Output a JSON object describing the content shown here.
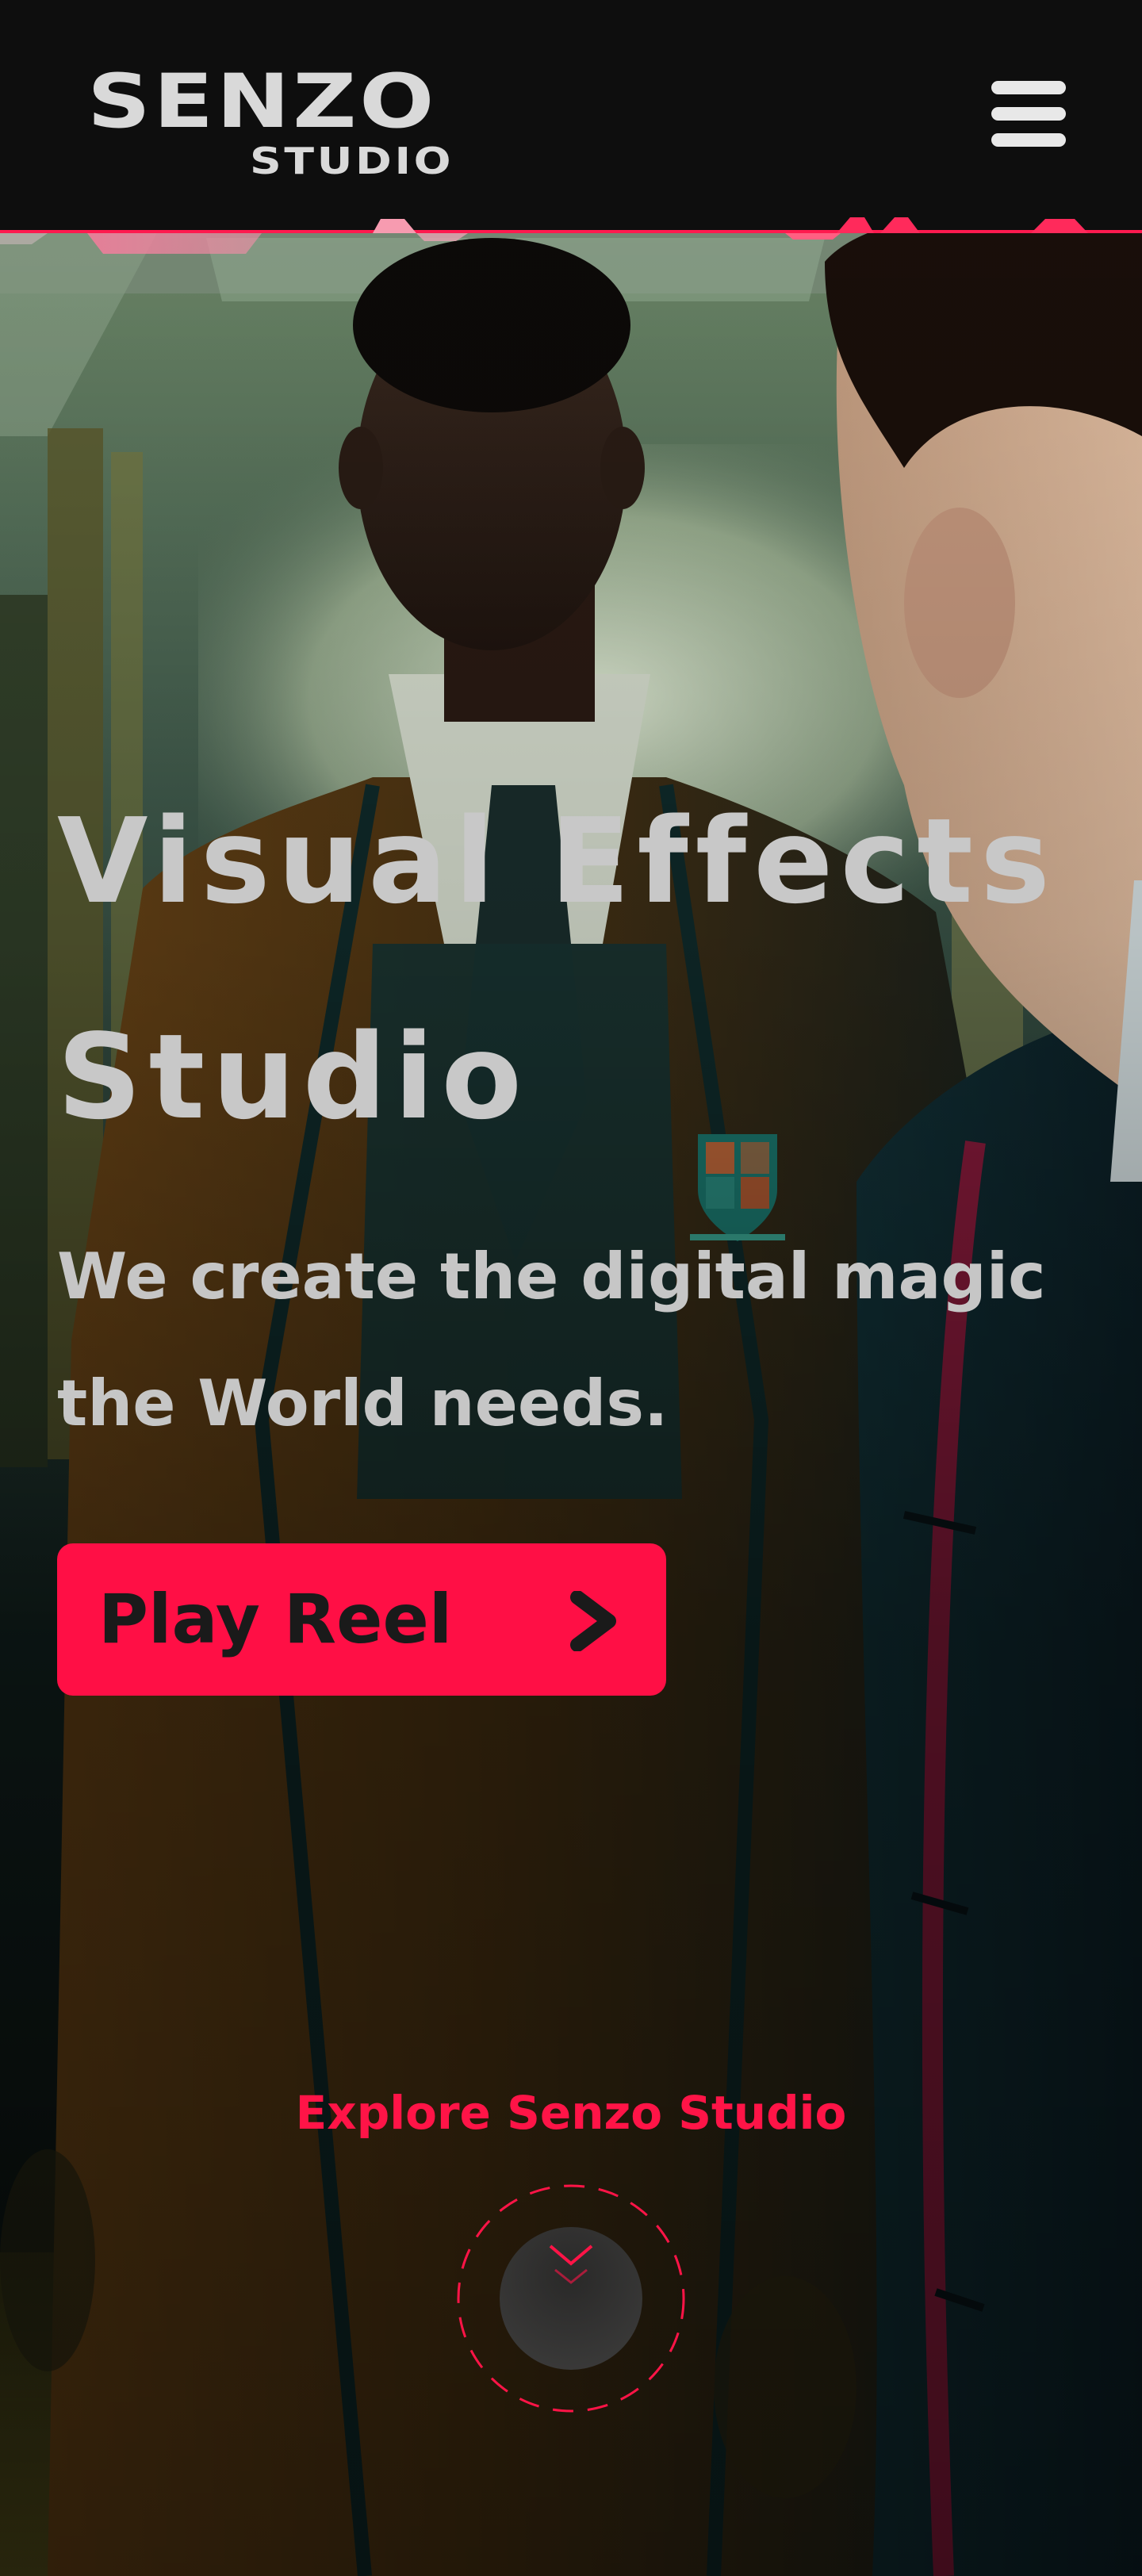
{
  "header": {
    "logo_main": "SENZO",
    "logo_sub": "STUDIO",
    "menu_icon": "hamburger-menu-icon"
  },
  "hero": {
    "title_line1": "Visual Effects",
    "title_line2": "Studio",
    "subtitle_line1": "We create the digital magic",
    "subtitle_line2": "the World needs.",
    "play_button_label": "Play Reel",
    "play_button_icon": "chevron-right-icon",
    "explore_label": "Explore Senzo Studio",
    "scroll_icon": "chevron-down-icon"
  },
  "colors": {
    "accent": "#ff0f45",
    "header_background": "#0e0e0e",
    "text_light": "#c8c8c8"
  }
}
